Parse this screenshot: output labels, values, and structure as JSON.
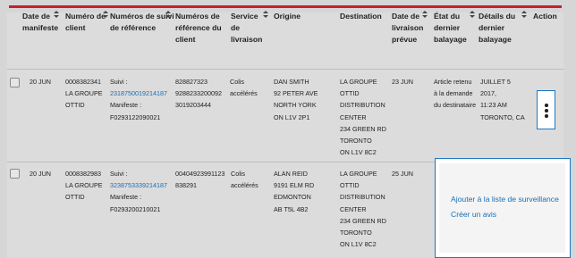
{
  "table": {
    "headers": [
      [
        "Date de",
        "manifeste"
      ],
      [
        "Numéro de",
        "client"
      ],
      [
        "Numéros de suivi",
        "de référence"
      ],
      [
        "Numéros de",
        "référence du",
        "client"
      ],
      [
        "Service",
        "de",
        "livraison"
      ],
      [
        "Origine"
      ],
      [
        "Destination"
      ],
      [
        "Date de",
        "livraison",
        "prévue"
      ],
      [
        "État du",
        "dernier",
        "balayage"
      ],
      [
        "Détails du",
        "dernier",
        "balayage"
      ],
      [
        "Action"
      ]
    ],
    "rows": [
      {
        "date": "20 JUN",
        "client": [
          "0008382341",
          "LA GROUPE",
          "OTTID"
        ],
        "tracking_prefix": "Suivi :",
        "tracking_number": "2318750019214187",
        "manifest_prefix": "Manifeste :",
        "manifest_number": "F0293122090021",
        "client_refs": [
          "828827323",
          "9288233200092",
          "3019203444"
        ],
        "service": [
          "Colis",
          "accélérés"
        ],
        "origin": [
          "DAN SMITH",
          "92 PETER AVE",
          "NORTH YORK",
          "ON L1V 2P1"
        ],
        "destination": [
          "LA GROUPE",
          "OTTID",
          "DISTRIBUTION",
          "CENTER",
          "234 GREEN RD",
          "TORONTO",
          "ON L1V 8C2"
        ],
        "expected": "23 JUN",
        "scan_status": [
          "Article retenu",
          "à la demande",
          "du destinataire"
        ],
        "scan_details": [
          "JUILLET 5",
          "2017,",
          "11:23 AM",
          "TORONTO, CA"
        ]
      },
      {
        "date": "20 JUN",
        "client": [
          "0008382983",
          "LA GROUPE",
          "OTTID"
        ],
        "tracking_prefix": "Suivi :",
        "tracking_number": "3238753339214187",
        "manifest_prefix": "Manifeste :",
        "manifest_number": "F0293200210021",
        "client_refs": [
          "00404923991123",
          "838291"
        ],
        "service": [
          "Colis",
          "accélérés"
        ],
        "origin": [
          "ALAN REID",
          "9191 ELM RD",
          "EDMONTON",
          "AB T5L 4B2"
        ],
        "destination": [
          "LA GROUPE",
          "OTTID",
          "DISTRIBUTION",
          "CENTER",
          "234 GREEN RD",
          "TORONTO",
          "ON L1V 8C2"
        ],
        "expected": "25 JUN"
      }
    ]
  },
  "popup": {
    "items": [
      "Ajouter à la liste de surveillance",
      "Créer un avis"
    ]
  },
  "colors": {
    "accent": "#c62127",
    "link": "#1a6fb5",
    "focus_border": "#1f77c0"
  },
  "icons": {
    "action_menu": "vertical-ellipsis-icon",
    "sort": "sort-arrows-icon"
  }
}
